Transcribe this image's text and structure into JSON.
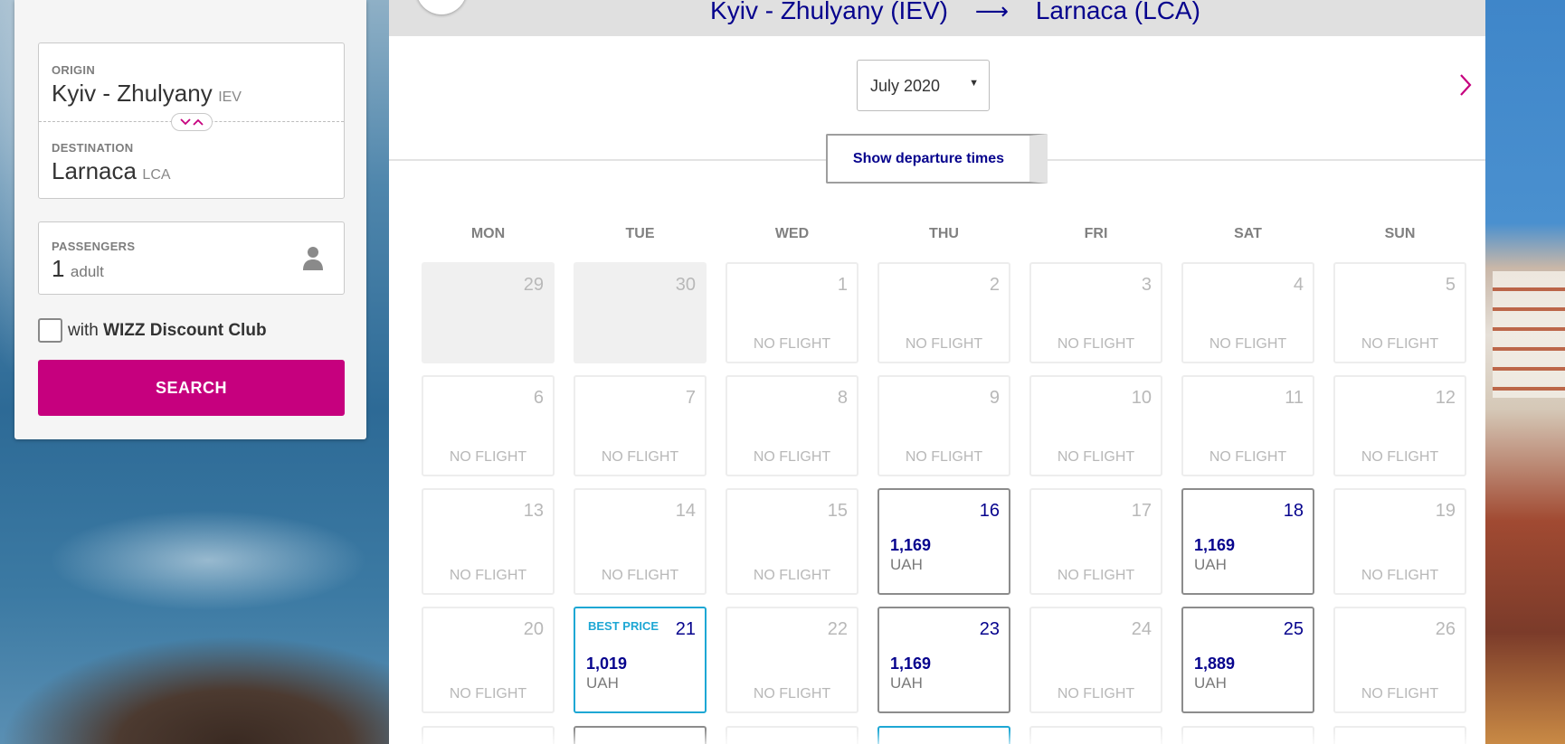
{
  "search": {
    "origin_label": "ORIGIN",
    "origin_city": "Kyiv - Zhulyany",
    "origin_code": "IEV",
    "destination_label": "DESTINATION",
    "destination_city": "Larnaca",
    "destination_code": "LCA",
    "passengers_label": "PASSENGERS",
    "passengers_count": "1",
    "passengers_unit": "adult",
    "discount_prefix": "with",
    "discount_name": "WIZZ Discount Club",
    "discount_checked": false,
    "search_button": "SEARCH",
    "swap_icon": "swap-chevrons-icon",
    "person_icon": "person-icon"
  },
  "header": {
    "origin": "Kyiv - Zhulyany (IEV)",
    "arrow": "⟶",
    "destination": "Larnaca (LCA)"
  },
  "calendar": {
    "month": "July 2020",
    "departure_times_button": "Show departure times",
    "weekdays": [
      "MON",
      "TUE",
      "WED",
      "THU",
      "FRI",
      "SAT",
      "SUN"
    ],
    "no_flight_text": "NO FLIGHT",
    "best_price_text": "BEST PRICE",
    "days": [
      {
        "day": "29",
        "state": "past"
      },
      {
        "day": "30",
        "state": "past"
      },
      {
        "day": "1",
        "state": "none"
      },
      {
        "day": "2",
        "state": "none"
      },
      {
        "day": "3",
        "state": "none"
      },
      {
        "day": "4",
        "state": "none"
      },
      {
        "day": "5",
        "state": "none"
      },
      {
        "day": "6",
        "state": "none"
      },
      {
        "day": "7",
        "state": "none"
      },
      {
        "day": "8",
        "state": "none"
      },
      {
        "day": "9",
        "state": "none"
      },
      {
        "day": "10",
        "state": "none"
      },
      {
        "day": "11",
        "state": "none"
      },
      {
        "day": "12",
        "state": "none"
      },
      {
        "day": "13",
        "state": "none"
      },
      {
        "day": "14",
        "state": "none"
      },
      {
        "day": "15",
        "state": "none"
      },
      {
        "day": "16",
        "state": "flight",
        "price": "1,169",
        "currency": "UAH"
      },
      {
        "day": "17",
        "state": "none"
      },
      {
        "day": "18",
        "state": "flight",
        "price": "1,169",
        "currency": "UAH"
      },
      {
        "day": "19",
        "state": "none"
      },
      {
        "day": "20",
        "state": "none"
      },
      {
        "day": "21",
        "state": "best",
        "price": "1,019",
        "currency": "UAH"
      },
      {
        "day": "22",
        "state": "none"
      },
      {
        "day": "23",
        "state": "flight",
        "price": "1,169",
        "currency": "UAH"
      },
      {
        "day": "24",
        "state": "none"
      },
      {
        "day": "25",
        "state": "flight",
        "price": "1,889",
        "currency": "UAH"
      },
      {
        "day": "26",
        "state": "none"
      }
    ]
  },
  "colors": {
    "brand_magenta": "#c6007e",
    "navy": "#06038d",
    "best_blue": "#1ea7d4"
  }
}
